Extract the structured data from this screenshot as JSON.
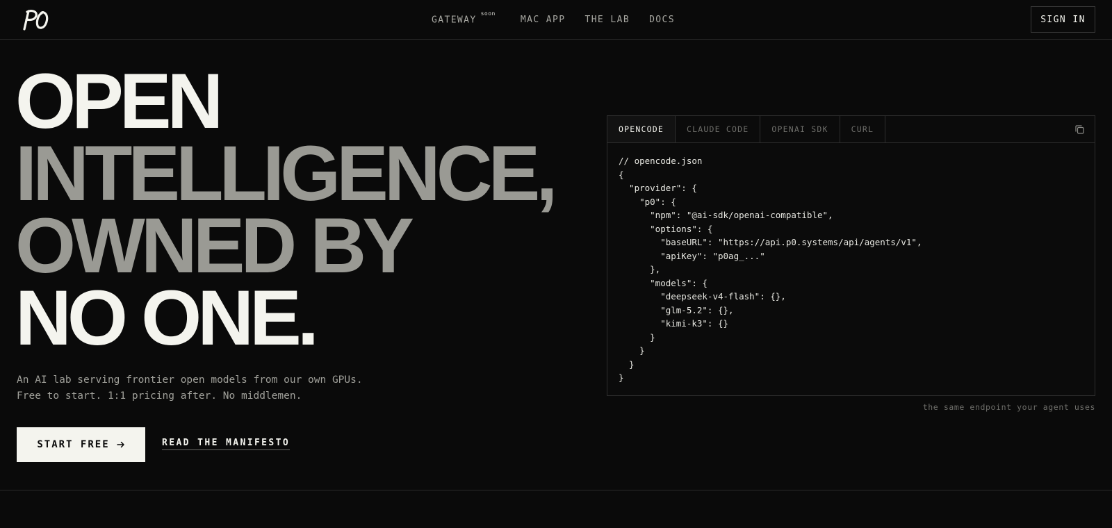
{
  "header": {
    "nav": [
      {
        "label": "GATEWAY",
        "badge": "soon"
      },
      {
        "label": "MAC APP"
      },
      {
        "label": "THE LAB"
      },
      {
        "label": "DOCS"
      }
    ],
    "signin_label": "SIGN IN"
  },
  "hero": {
    "headline": {
      "line1": "OPEN",
      "line2": "INTELLIGENCE,",
      "line3": "OWNED BY",
      "line4": "NO ONE."
    },
    "subtext": "An AI lab serving frontier open models from our own GPUs. Free to start. 1:1 pricing after. No middlemen.",
    "cta_label": "START FREE",
    "secondary_link": "READ THE MANIFESTO"
  },
  "code_panel": {
    "tabs": [
      "OPENCODE",
      "CLAUDE CODE",
      "OPENAI SDK",
      "CURL"
    ],
    "active_tab": 0,
    "code": "// opencode.json\n{\n  \"provider\": {\n    \"p0\": {\n      \"npm\": \"@ai-sdk/openai-compatible\",\n      \"options\": {\n        \"baseURL\": \"https://api.p0.systems/api/agents/v1\",\n        \"apiKey\": \"p0ag_...\"\n      },\n      \"models\": {\n        \"deepseek-v4-flash\": {},\n        \"glm-5.2\": {},\n        \"kimi-k3\": {}\n      }\n    }\n  }\n}",
    "caption": "the same endpoint your agent uses"
  },
  "colors": {
    "background": "#0a0a0a",
    "foreground": "#f4f4ee",
    "muted": "#9a9a94",
    "border": "#2a2a2a"
  },
  "icons": {
    "logo": "p0-logo",
    "cta_arrow": "arrow-right-icon",
    "copy": "copy-icon"
  }
}
